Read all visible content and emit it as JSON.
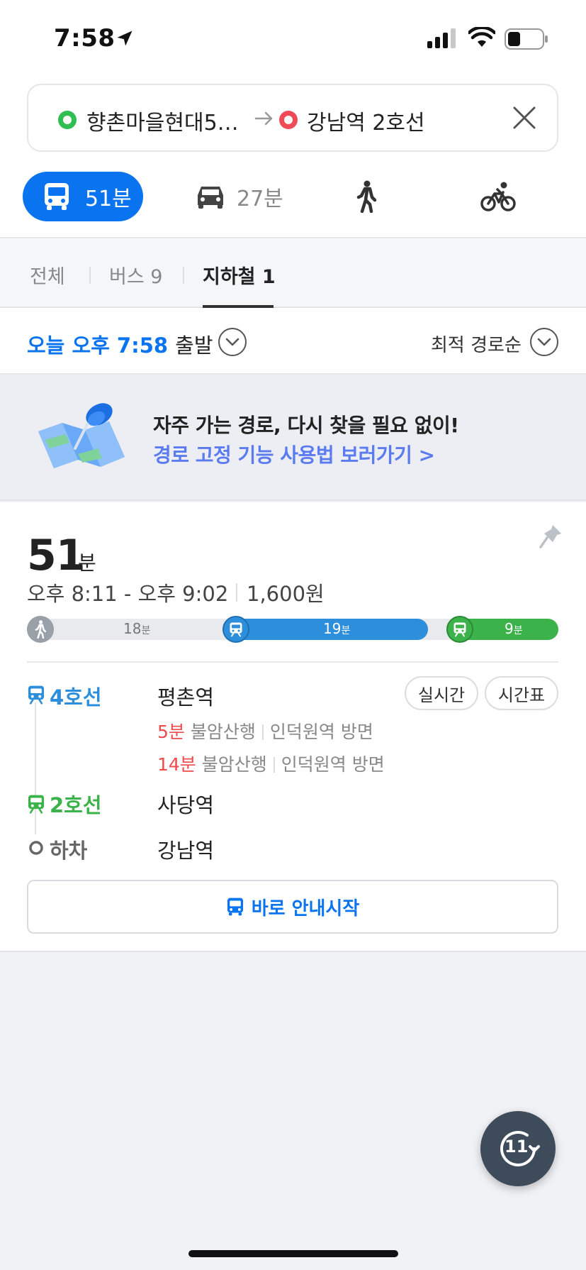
{
  "status_bar": {
    "time": "7:58"
  },
  "search": {
    "origin": "향촌마을현대5…",
    "destination": "강남역 2호선"
  },
  "modes": {
    "transit": "51분",
    "car": "27분"
  },
  "subtabs": {
    "all": "전체",
    "bus": "버스 9",
    "subway": "지하철 1"
  },
  "departure": {
    "time": "오늘 오후 7:58",
    "suffix": "출발",
    "sort": "최적 경로순"
  },
  "banner": {
    "title": "자주 가는 경로, 다시 찾을 필요 없이!",
    "link": "경로 고정 기능 사용법 보러가기 >"
  },
  "route": {
    "duration": "51",
    "duration_unit": "분",
    "time_range": "오후 8:11 - 오후 9:02",
    "fare": "1,600원",
    "segments": [
      {
        "mins": "18",
        "unit": "분",
        "fraction": 0.37
      },
      {
        "mins": "19",
        "unit": "분",
        "fraction": 0.4
      },
      {
        "mins": "9",
        "unit": "분",
        "fraction": 0.23
      }
    ],
    "steps": [
      {
        "line": "4호선",
        "station": "평촌역",
        "arrivals": [
          {
            "min": "5분",
            "dest": "불암산행",
            "dir": "인덕원역 방면"
          },
          {
            "min": "14분",
            "dest": "불암산행",
            "dir": "인덕원역 방면"
          }
        ]
      },
      {
        "line": "2호선",
        "station": "사당역"
      },
      {
        "line": "하차",
        "station": "강남역"
      }
    ],
    "realtime_button": "실시간",
    "timetable_button": "시간표",
    "start_nav_button": "바로 안내시작"
  },
  "fab": {
    "label": "11"
  },
  "colors": {
    "accent": "#0a74f0",
    "line4": "#2d8fdb",
    "line2": "#3bb34a",
    "alert": "#f04a4a"
  }
}
